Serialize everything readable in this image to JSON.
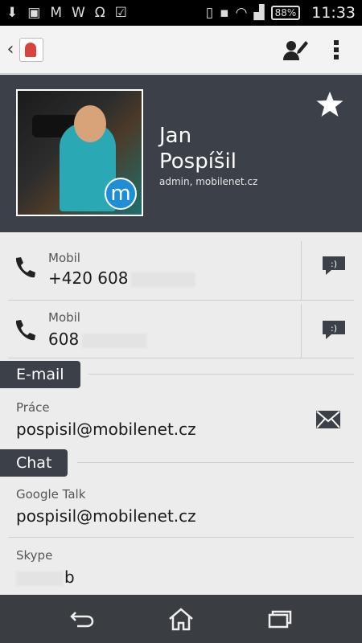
{
  "status_bar": {
    "battery": "88%",
    "time": "11:33"
  },
  "contact": {
    "first_name": "Jan",
    "last_name": "Pospíšil",
    "subtitle": "admin, mobilenet.cz",
    "badge_letter": "m"
  },
  "phones": [
    {
      "label": "Mobil",
      "value": "+420 608"
    },
    {
      "label": "Mobil",
      "value": "608"
    }
  ],
  "sections": {
    "email": "E-mail",
    "chat": "Chat"
  },
  "email": {
    "label": "Práce",
    "value": "pospisil@mobilenet.cz"
  },
  "chat": [
    {
      "label": "Google Talk",
      "value": "pospisil@mobilenet.cz"
    },
    {
      "label": "Skype",
      "value": "b"
    }
  ],
  "icons": {
    "back": "chevron-left-icon",
    "app": "contacts-app-icon",
    "edit": "edit-contact-icon",
    "menu": "overflow-menu-icon",
    "star": "star-icon",
    "phone": "phone-icon",
    "sms": "sms-icon",
    "mail": "email-icon",
    "nav_back": "back-icon",
    "nav_home": "home-icon",
    "nav_recents": "recents-icon"
  },
  "colors": {
    "header_bg": "#3c4149",
    "content_bg": "#ececec",
    "accent_badge": "#1e8fd6"
  }
}
